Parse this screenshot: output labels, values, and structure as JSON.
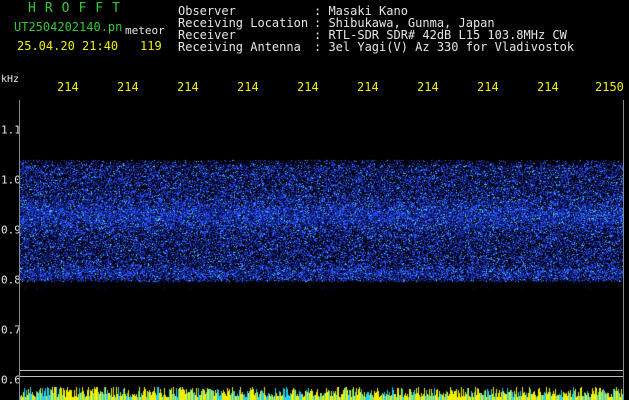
{
  "header": {
    "brand": "HROFFT",
    "filename": "UT2504202140.pn",
    "mode": "meteor",
    "datetime": "25.04.20 21:40",
    "count": "119"
  },
  "info": [
    {
      "label": "Observer",
      "value": ": Masaki Kano"
    },
    {
      "label": "Receiving Location",
      "value": ": Shibukawa, Gunma, Japan"
    },
    {
      "label": "Receiver",
      "value": ": RTL-SDR SDR# 42dB L15 103.8MHz CW"
    },
    {
      "label": "Receiving Antenna",
      "value": ": 3el Yagi(V) Az 330 for Vladivostok"
    }
  ],
  "axes": {
    "y_unit": "kHz",
    "y_ticks": [
      "1.1",
      "1.0",
      "0.9",
      "0.8",
      "0.7",
      "0.6"
    ],
    "x_ticks": [
      "214",
      "214",
      "214",
      "214",
      "214",
      "214",
      "214",
      "214",
      "214",
      "2150"
    ]
  },
  "colors": {
    "band_dark": "#0f1e78",
    "band_mid": "#2850ff",
    "band_bright": "#46c8ff",
    "hit": "#3cd28c",
    "strip_yellow": "#f0f000",
    "strip_cyan": "#28d2f0"
  }
}
